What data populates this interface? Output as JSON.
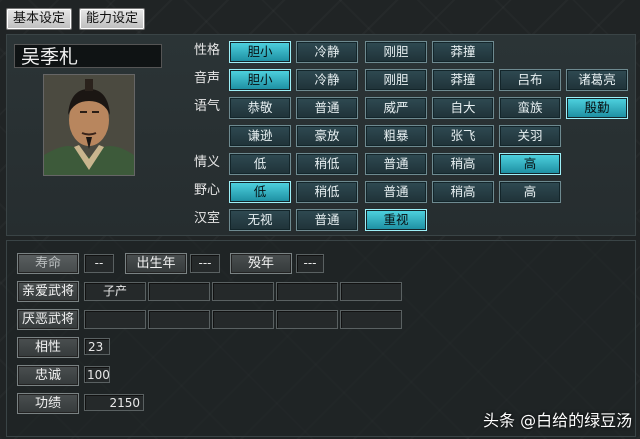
{
  "tabs": {
    "basic": "基本设定",
    "ability": "能力设定"
  },
  "character": {
    "name": "吴季札"
  },
  "personality": {
    "label": "性格",
    "options": [
      "胆小",
      "冷静",
      "刚胆",
      "莽撞"
    ],
    "selected": 0
  },
  "voice": {
    "label": "音声",
    "options": [
      "胆小",
      "冷静",
      "刚胆",
      "莽撞",
      "吕布",
      "诸葛亮"
    ],
    "selected": 0
  },
  "tone": {
    "label": "语气",
    "options_row1": [
      "恭敬",
      "普通",
      "威严",
      "自大",
      "蛮族",
      "殷勤"
    ],
    "options_row2": [
      "谦逊",
      "豪放",
      "粗暴",
      "张飞",
      "关羽"
    ],
    "selected": "殷勤"
  },
  "righteousness": {
    "label": "情义",
    "options": [
      "低",
      "稍低",
      "普通",
      "稍高",
      "高"
    ],
    "selected": 4
  },
  "ambition": {
    "label": "野心",
    "options": [
      "低",
      "稍低",
      "普通",
      "稍高",
      "高"
    ],
    "selected": 0
  },
  "han_dynasty": {
    "label": "汉室",
    "options": [
      "无视",
      "普通",
      "重视"
    ],
    "selected": 2
  },
  "lifespan": {
    "label": "寿命",
    "value": "--"
  },
  "birth_year": {
    "label": "出生年",
    "value": "---"
  },
  "death_year": {
    "label": "殁年",
    "value": "---"
  },
  "liked_generals": {
    "label": "亲爱武将",
    "values": [
      "子产",
      "",
      "",
      "",
      ""
    ]
  },
  "disliked_generals": {
    "label": "厌恶武将",
    "values": [
      "",
      "",
      "",
      "",
      ""
    ]
  },
  "compatibility": {
    "label": "相性",
    "value": "23"
  },
  "loyalty": {
    "label": "忠诚",
    "value": "100"
  },
  "merit": {
    "label": "功绩",
    "value": "2150"
  },
  "watermark": "头条 @白给的绿豆汤"
}
